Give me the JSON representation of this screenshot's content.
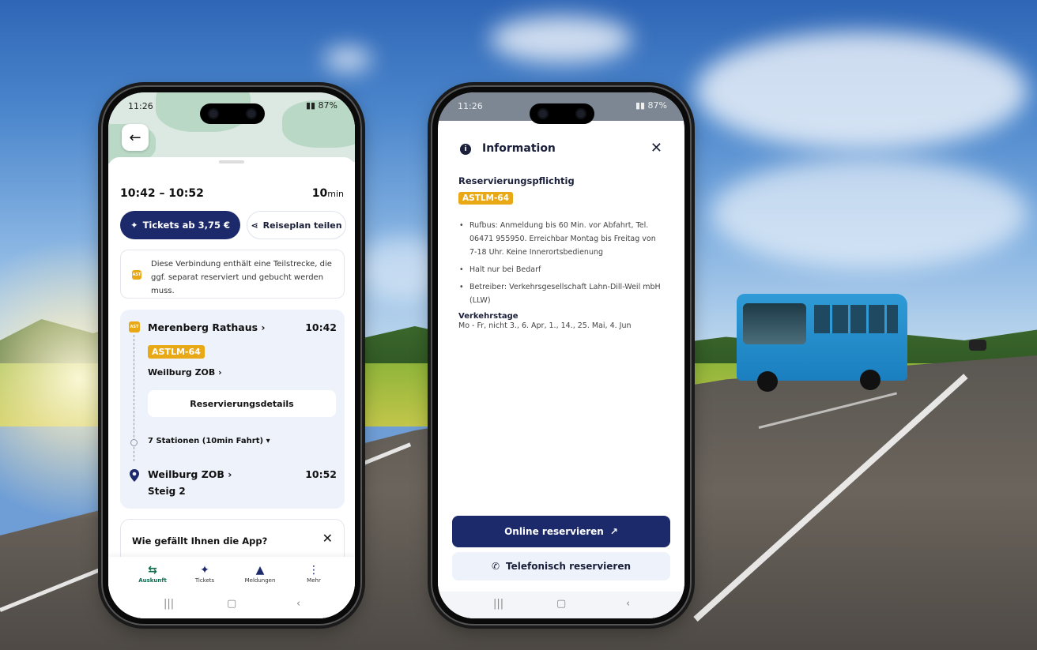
{
  "left_phone": {
    "status": {
      "time": "11:26",
      "battery": "87%"
    },
    "trip": {
      "time_range": "10:42 – 10:52",
      "duration_value": "10",
      "duration_unit": "min"
    },
    "actions": {
      "tickets_label": "Tickets ab 3,75 €",
      "share_label": "Reiseplan teilen"
    },
    "notice": {
      "badge": "AST",
      "text": "Diese Verbindung enthält eine Teilstrecke, die ggf. separat reserviert und gebucht werden muss."
    },
    "route": {
      "badge": "AST",
      "origin": {
        "name": "Merenberg Rathaus",
        "time": "10:42"
      },
      "line": "ASTLM-64",
      "direction": "Weilburg ZOB",
      "reservation_details_label": "Reservierungsdetails",
      "stations_summary": "7 Stationen (10min Fahrt)",
      "destination": {
        "name": "Weilburg ZOB",
        "time": "10:52",
        "platform": "Steig 2"
      }
    },
    "feedback": {
      "question": "Wie gefällt Ihnen die App?"
    },
    "tabs": [
      {
        "label": "Auskunft",
        "icon": "arrows-swap-icon"
      },
      {
        "label": "Tickets",
        "icon": "ticket-icon"
      },
      {
        "label": "Meldungen",
        "icon": "warning-icon"
      },
      {
        "label": "Mehr",
        "icon": "more-vertical-icon"
      }
    ]
  },
  "right_phone": {
    "status": {
      "time": "11:26",
      "battery": "87%"
    },
    "modal": {
      "title": "Information",
      "heading": "Reservierungspflichtig",
      "line": "ASTLM-64",
      "bullets": [
        "Rufbus: Anmeldung bis 60 Min. vor Abfahrt, Tel. 06471 955950. Erreichbar Montag bis Freitag von 7-18 Uhr. Keine Innerortsbedienung",
        "Halt nur bei Bedarf",
        "Betreiber: Verkehrsgesellschaft Lahn-Dill-Weil mbH (LLW)"
      ],
      "days_heading": "Verkehrstage",
      "days_value": "Mo - Fr, nicht 3., 6. Apr, 1., 14., 25. Mai, 4. Jun",
      "online_label": "Online reservieren",
      "phone_label": "Telefonisch reservieren"
    }
  },
  "colors": {
    "primary": "#1c2a6b",
    "accent": "#e9a815",
    "active_tab": "#0f6b4f",
    "card_bg": "#eef3fb"
  }
}
